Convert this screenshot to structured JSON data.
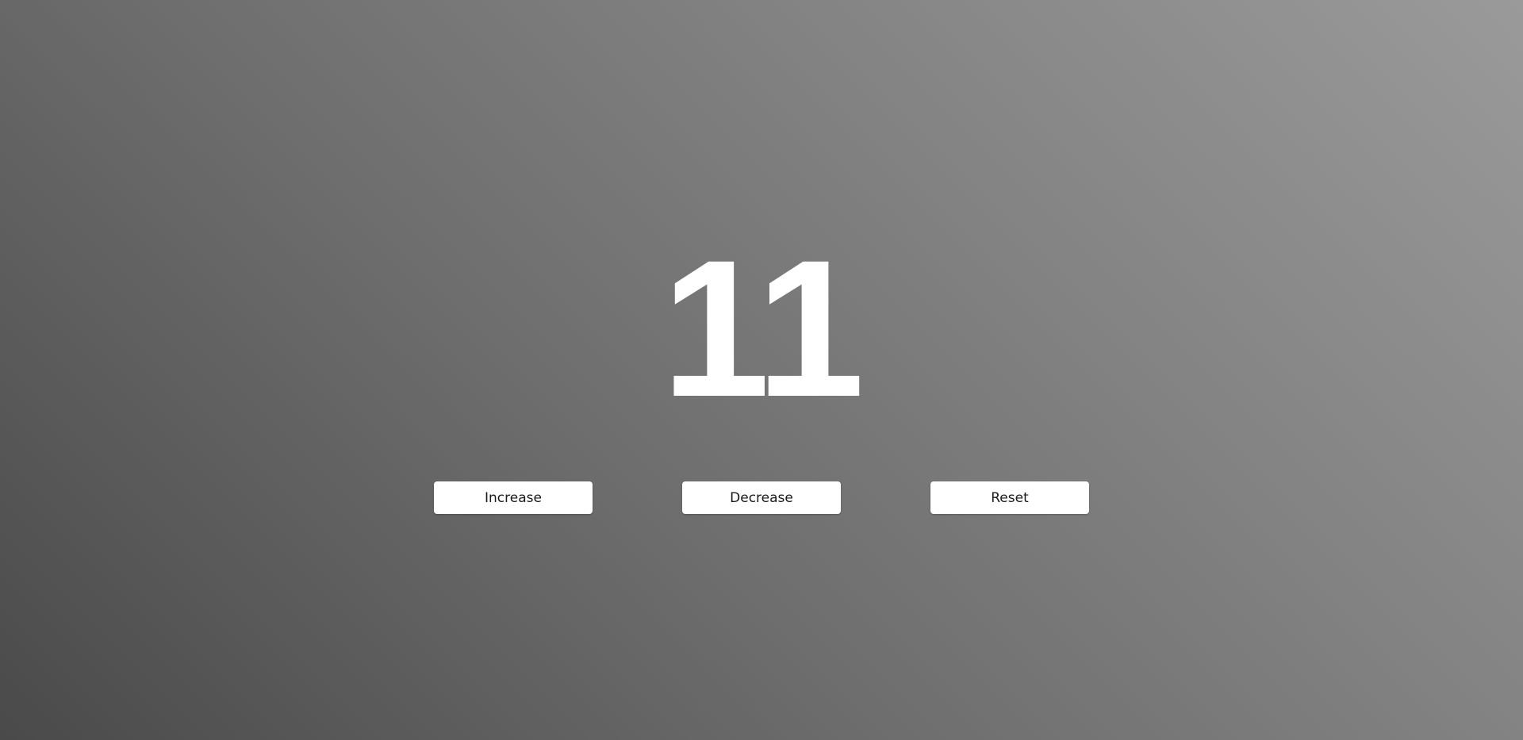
{
  "counter": {
    "value": "11"
  },
  "buttons": {
    "increase_label": "Increase",
    "decrease_label": "Decrease",
    "reset_label": "Reset"
  },
  "colors": {
    "background_dark": "#4a4a4a",
    "background_light": "#9a9a9a",
    "counter_text": "#ffffff",
    "button_bg": "#ffffff",
    "button_text": "#1a1a1a"
  }
}
